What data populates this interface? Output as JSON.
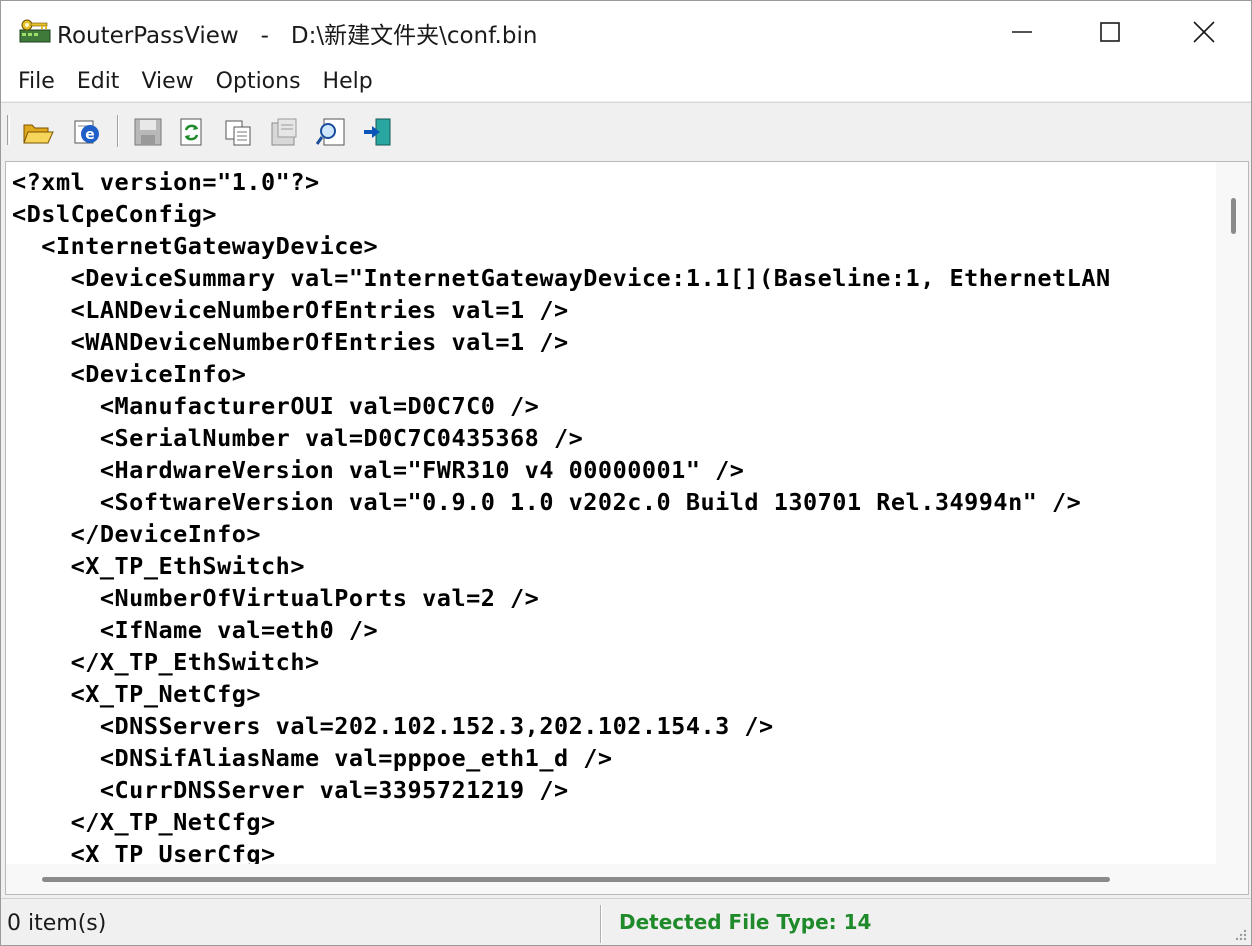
{
  "window": {
    "app_name": "RouterPassView",
    "separator": " - ",
    "file_path": "D:\\新建文件夹\\conf.bin"
  },
  "menu": [
    "File",
    "Edit",
    "View",
    "Options",
    "Help"
  ],
  "toolbar": {
    "buttons": [
      {
        "name": "open-folder-icon"
      },
      {
        "name": "internet-explorer-icon"
      },
      {
        "name": "save-icon"
      },
      {
        "name": "refresh-icon"
      },
      {
        "name": "copy-icon"
      },
      {
        "name": "properties-icon"
      },
      {
        "name": "find-icon"
      },
      {
        "name": "exit-icon"
      }
    ]
  },
  "xml_lines": [
    "<?xml version=\"1.0\"?>",
    "<DslCpeConfig>",
    "  <InternetGatewayDevice>",
    "    <DeviceSummary val=\"InternetGatewayDevice:1.1[](Baseline:1, EthernetLAN",
    "    <LANDeviceNumberOfEntries val=1 />",
    "    <WANDeviceNumberOfEntries val=1 />",
    "    <DeviceInfo>",
    "      <ManufacturerOUI val=D0C7C0 />",
    "      <SerialNumber val=D0C7C0435368 />",
    "      <HardwareVersion val=\"FWR310 v4 00000001\" />",
    "      <SoftwareVersion val=\"0.9.0 1.0 v202c.0 Build 130701 Rel.34994n\" />",
    "    </DeviceInfo>",
    "    <X_TP_EthSwitch>",
    "      <NumberOfVirtualPorts val=2 />",
    "      <IfName val=eth0 />",
    "    </X_TP_EthSwitch>",
    "    <X_TP_NetCfg>",
    "      <DNSServers val=202.102.152.3,202.102.154.3 />",
    "      <DNSifAliasName val=pppoe_eth1_d />",
    "      <CurrDNSServer val=3395721219 />",
    "    </X_TP_NetCfg>",
    "    <X_TP_UserCfg>"
  ],
  "status": {
    "items": "0 item(s)",
    "file_type": "Detected File Type: 14"
  },
  "colors": {
    "status_green": "#1f8a2a",
    "window_bg": "#f0f0f0"
  }
}
